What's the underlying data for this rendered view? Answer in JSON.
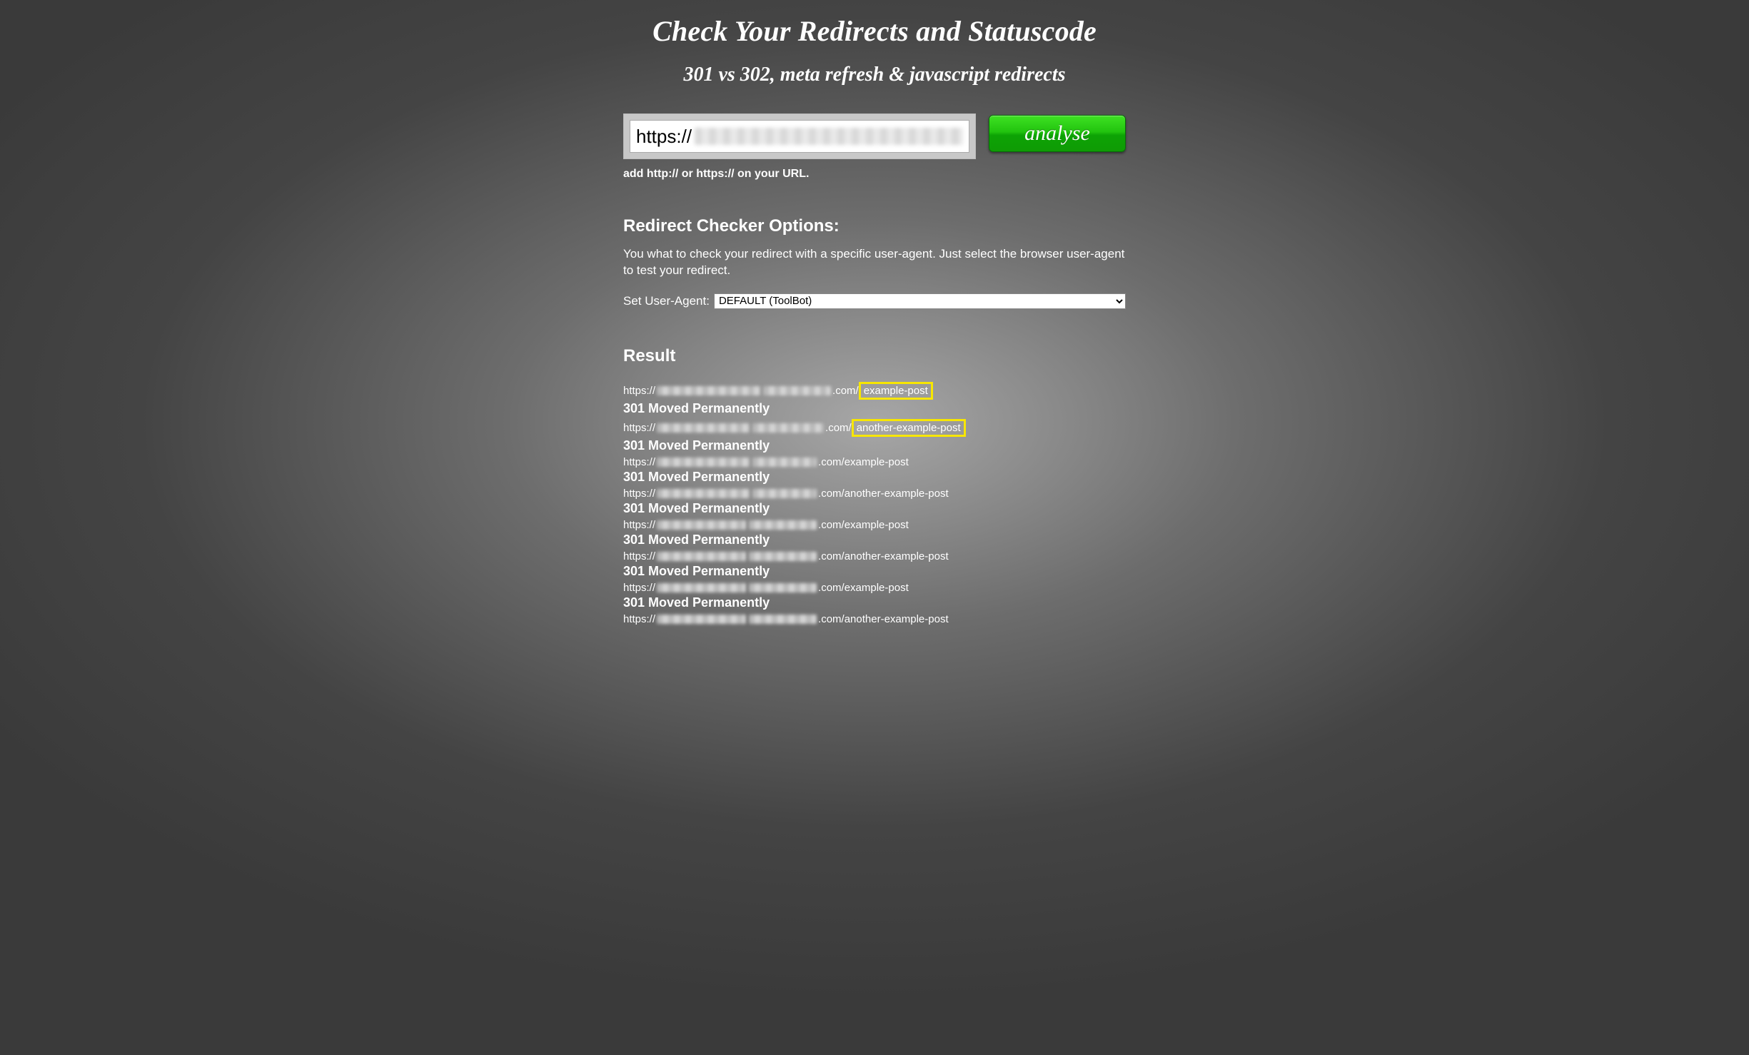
{
  "header": {
    "title": "Check Your Redirects and Statuscode",
    "subtitle": "301 vs 302, meta refresh & javascript redirects"
  },
  "form": {
    "url_prefix": "https://",
    "analyse_label": "analyse",
    "hint": "add http:// or https:// on your URL."
  },
  "options": {
    "title": "Redirect Checker Options:",
    "description": "You what to check your redirect with a specific user-agent. Just select the browser user-agent to test your redirect.",
    "ua_label": "Set User-Agent:",
    "ua_selected": "DEFAULT (ToolBot)"
  },
  "result": {
    "title": "Result",
    "entries": [
      {
        "prefix": "https://",
        "domain_suffix": ".com/",
        "path": "example-post",
        "highlight": true,
        "status": "301 Moved Permanently",
        "blur1_w": 145,
        "blur2_w": 95
      },
      {
        "prefix": "https://",
        "domain_suffix": ".com/",
        "path": "another-example-post",
        "highlight": true,
        "status": "301 Moved Permanently",
        "blur1_w": 130,
        "blur2_w": 100
      },
      {
        "prefix": "https://",
        "domain_suffix": ".com/example-post",
        "path": "",
        "highlight": false,
        "status": "301 Moved Permanently",
        "blur1_w": 130,
        "blur2_w": 90
      },
      {
        "prefix": "https://",
        "domain_suffix": ".com/another-example-post",
        "path": "",
        "highlight": false,
        "status": "301 Moved Permanently",
        "blur1_w": 130,
        "blur2_w": 90
      },
      {
        "prefix": "https://",
        "domain_suffix": ".com/example-post",
        "path": "",
        "highlight": false,
        "status": "301 Moved Permanently",
        "blur1_w": 125,
        "blur2_w": 95
      },
      {
        "prefix": "https://",
        "domain_suffix": ".com/another-example-post",
        "path": "",
        "highlight": false,
        "status": "301 Moved Permanently",
        "blur1_w": 125,
        "blur2_w": 95
      },
      {
        "prefix": "https://",
        "domain_suffix": ".com/example-post",
        "path": "",
        "highlight": false,
        "status": "301 Moved Permanently",
        "blur1_w": 125,
        "blur2_w": 95
      },
      {
        "prefix": "https://",
        "domain_suffix": ".com/another-example-post",
        "path": "",
        "highlight": false,
        "status": "",
        "blur1_w": 125,
        "blur2_w": 95
      }
    ]
  }
}
